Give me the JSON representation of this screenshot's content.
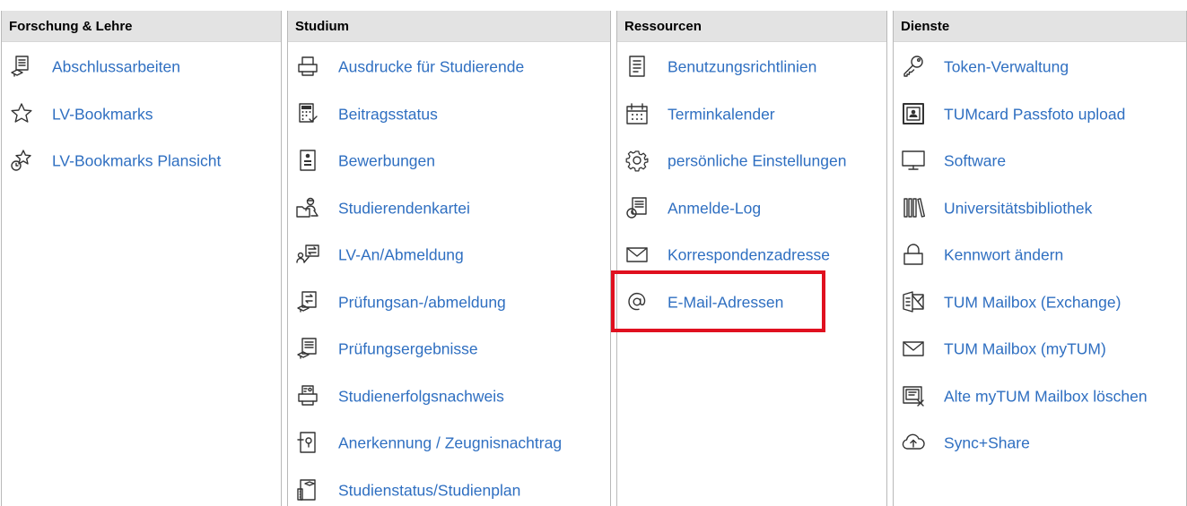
{
  "columns": [
    {
      "header": "Forschung & Lehre",
      "items": [
        {
          "label": "Abschlussarbeiten",
          "icon": "thesis-doc-icon"
        },
        {
          "label": "LV-Bookmarks",
          "icon": "star-icon"
        },
        {
          "label": "LV-Bookmarks Plansicht",
          "icon": "star-clock-icon"
        }
      ]
    },
    {
      "header": "Studium",
      "items": [
        {
          "label": "Ausdrucke für Studierende",
          "icon": "printer-icon"
        },
        {
          "label": "Beitragsstatus",
          "icon": "calculator-check-icon"
        },
        {
          "label": "Bewerbungen",
          "icon": "applicant-card-icon"
        },
        {
          "label": "Studierendenkartei",
          "icon": "student-folder-icon"
        },
        {
          "label": "LV-An/Abmeldung",
          "icon": "course-register-icon"
        },
        {
          "label": "Prüfungsan-/abmeldung",
          "icon": "exam-register-icon"
        },
        {
          "label": "Prüfungsergebnisse",
          "icon": "exam-results-icon"
        },
        {
          "label": "Studienerfolgsnachweis",
          "icon": "printer-certificate-icon"
        },
        {
          "label": "Anerkennung / Zeugnisnachtrag",
          "icon": "recognition-doc-icon"
        },
        {
          "label": "Studienstatus/Studienplan",
          "icon": "study-plan-icon"
        }
      ]
    },
    {
      "header": "Ressourcen",
      "items": [
        {
          "label": "Benutzungsrichtlinien",
          "icon": "document-lines-icon"
        },
        {
          "label": "Terminkalender",
          "icon": "calendar-icon"
        },
        {
          "label": "persönliche Einstellungen",
          "icon": "gear-icon"
        },
        {
          "label": "Anmelde-Log",
          "icon": "log-doc-clock-icon"
        },
        {
          "label": "Korrespondenzadresse",
          "icon": "envelope-icon"
        },
        {
          "label": "E-Mail-Adressen",
          "icon": "at-sign-icon"
        }
      ]
    },
    {
      "header": "Dienste",
      "items": [
        {
          "label": "Token-Verwaltung",
          "icon": "key-icon"
        },
        {
          "label": "TUMcard Passfoto upload",
          "icon": "id-photo-icon"
        },
        {
          "label": "Software",
          "icon": "monitor-icon"
        },
        {
          "label": "Universitätsbibliothek",
          "icon": "library-books-icon"
        },
        {
          "label": "Kennwort ändern",
          "icon": "lock-icon"
        },
        {
          "label": "TUM Mailbox (Exchange)",
          "icon": "exchange-mailbox-icon"
        },
        {
          "label": "TUM Mailbox (myTUM)",
          "icon": "envelope-icon"
        },
        {
          "label": "Alte myTUM Mailbox löschen",
          "icon": "mailbox-delete-icon"
        },
        {
          "label": "Sync+Share",
          "icon": "cloud-upload-icon"
        }
      ]
    }
  ],
  "colors": {
    "link": "#2f6fc1",
    "header_bg": "#e3e3e3",
    "highlight": "#e0101f"
  }
}
